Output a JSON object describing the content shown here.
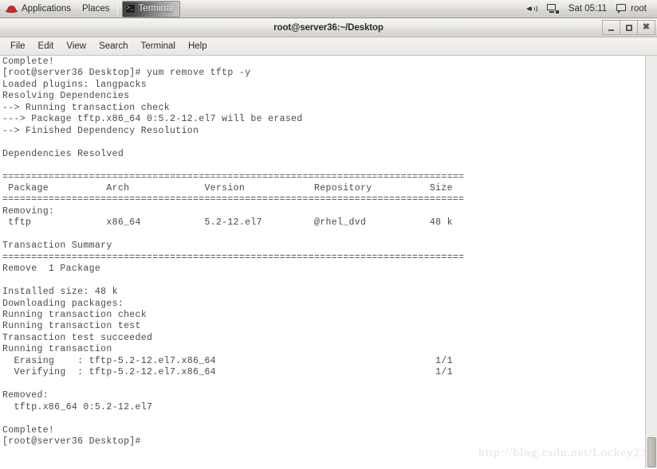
{
  "desktop": {
    "panel": {
      "logo_icon": "redhat-logo-icon",
      "applications_label": "Applications",
      "places_label": "Places",
      "taskbar": {
        "window_icon": ">_",
        "window_label": "Terminal"
      },
      "tray": {
        "volume_icon": "speaker-icon",
        "network_icon": "network-display-icon",
        "clock_label": "Sat 05:11",
        "message_icon": "message-icon",
        "user_label": "root"
      }
    }
  },
  "window": {
    "title": "root@server36:~/Desktop",
    "controls": {
      "minimize_label": "minimize",
      "maximize_label": "maximize",
      "close_label": "close"
    },
    "menu": [
      {
        "label": "File"
      },
      {
        "label": "Edit"
      },
      {
        "label": "View"
      },
      {
        "label": "Search"
      },
      {
        "label": "Terminal"
      },
      {
        "label": "Help"
      }
    ]
  },
  "terminal": {
    "prompt": "[root@server36 Desktop]#",
    "command": "yum remove tftp -y",
    "package": {
      "name": "tftp",
      "arch": "x86_64",
      "version": "5.2-12.el7",
      "repository": "@rhel_dvd",
      "size": "48 k",
      "nevra": "tftp.x86_64 0:5.2-12.el7",
      "full_file": "tftp-5.2-12.el7.x86_64"
    },
    "columns": [
      "Package",
      "Arch",
      "Version",
      "Repository",
      "Size"
    ],
    "summary": {
      "heading": "Transaction Summary",
      "action_line": "Remove  1 Package",
      "installed_size": "Installed size: 48 k",
      "progress": "1/1"
    },
    "output": "Complete!\n[root@server36 Desktop]# yum remove tftp -y\nLoaded plugins: langpacks\nResolving Dependencies\n--> Running transaction check\n---> Package tftp.x86_64 0:5.2-12.el7 will be erased\n--> Finished Dependency Resolution\n\nDependencies Resolved\n\n================================================================================\n Package          Arch             Version            Repository          Size\n================================================================================\nRemoving:\n tftp             x86_64           5.2-12.el7         @rhel_dvd           48 k\n\nTransaction Summary\n================================================================================\nRemove  1 Package\n\nInstalled size: 48 k\nDownloading packages:\nRunning transaction check\nRunning transaction test\nTransaction test succeeded\nRunning transaction\n  Erasing    : tftp-5.2-12.el7.x86_64                                      1/1\n  Verifying  : tftp-5.2-12.el7.x86_64                                      1/1\n\nRemoved:\n  tftp.x86_64 0:5.2-12.el7\n\nComplete!\n[root@server36 Desktop]#"
  },
  "watermark": {
    "text": "http://blog.csdn.net/Lockey23"
  },
  "colors": {
    "panel_bg": "#dcdad5",
    "terminal_bg": "#ffffff",
    "terminal_fg": "#4a4a4a",
    "accent_red": "#c42b23",
    "watermark": "#e3e3e3"
  }
}
